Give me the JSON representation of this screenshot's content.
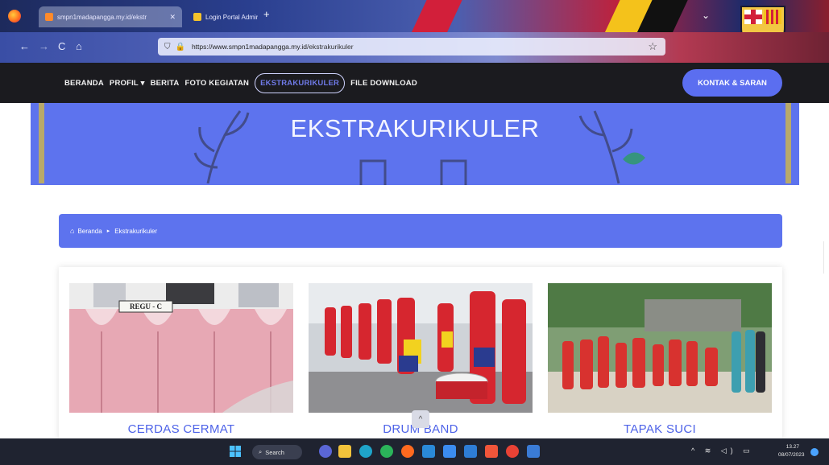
{
  "browser": {
    "tabs": [
      {
        "label": "smpn1madapangga.my.id/ekstr"
      },
      {
        "label": "Login Portal Admin SMP Negeri"
      }
    ],
    "new_tab": "+",
    "back": "←",
    "forward": "→",
    "reload": "C",
    "home": "⌂",
    "url_host": "https://www.smpn1madapangga.my.id",
    "url_path": "/ekstrakurikuler",
    "shield": "⛉",
    "lock": "🔒",
    "star": "☆",
    "tab_list": "⌄"
  },
  "nav": {
    "items": [
      {
        "label": "BERANDA"
      },
      {
        "label": "PROFIL ▾"
      },
      {
        "label": "BERITA"
      },
      {
        "label": "FOTO KEGIATAN"
      },
      {
        "label": "EKSTRAKURIKULER"
      },
      {
        "label": "FILE DOWNLOAD"
      }
    ],
    "contact_label": "KONTAK & SARAN"
  },
  "hero": {
    "title": "EKSTRAKURIKULER"
  },
  "breadcrumb": {
    "home_icon": "⌂",
    "home_label": "Beranda",
    "separator": "▸",
    "current": "Ekstrakurikuler"
  },
  "cards": [
    {
      "caption": "CERDAS CERMAT",
      "photo_sign": "REGU - C"
    },
    {
      "caption": "DRUM BAND"
    },
    {
      "caption": "TAPAK SUCI"
    }
  ],
  "scroll_top": "^",
  "taskbar": {
    "search_label": "Search",
    "search_icon": "⌕",
    "tray": "^ ≋ ◁) ▭",
    "time": "13.27",
    "date": "08/07/2023"
  },
  "colors": {
    "accent": "#5d73ee",
    "nav_bg": "#1b1b1f",
    "caption": "#4e63e8"
  }
}
